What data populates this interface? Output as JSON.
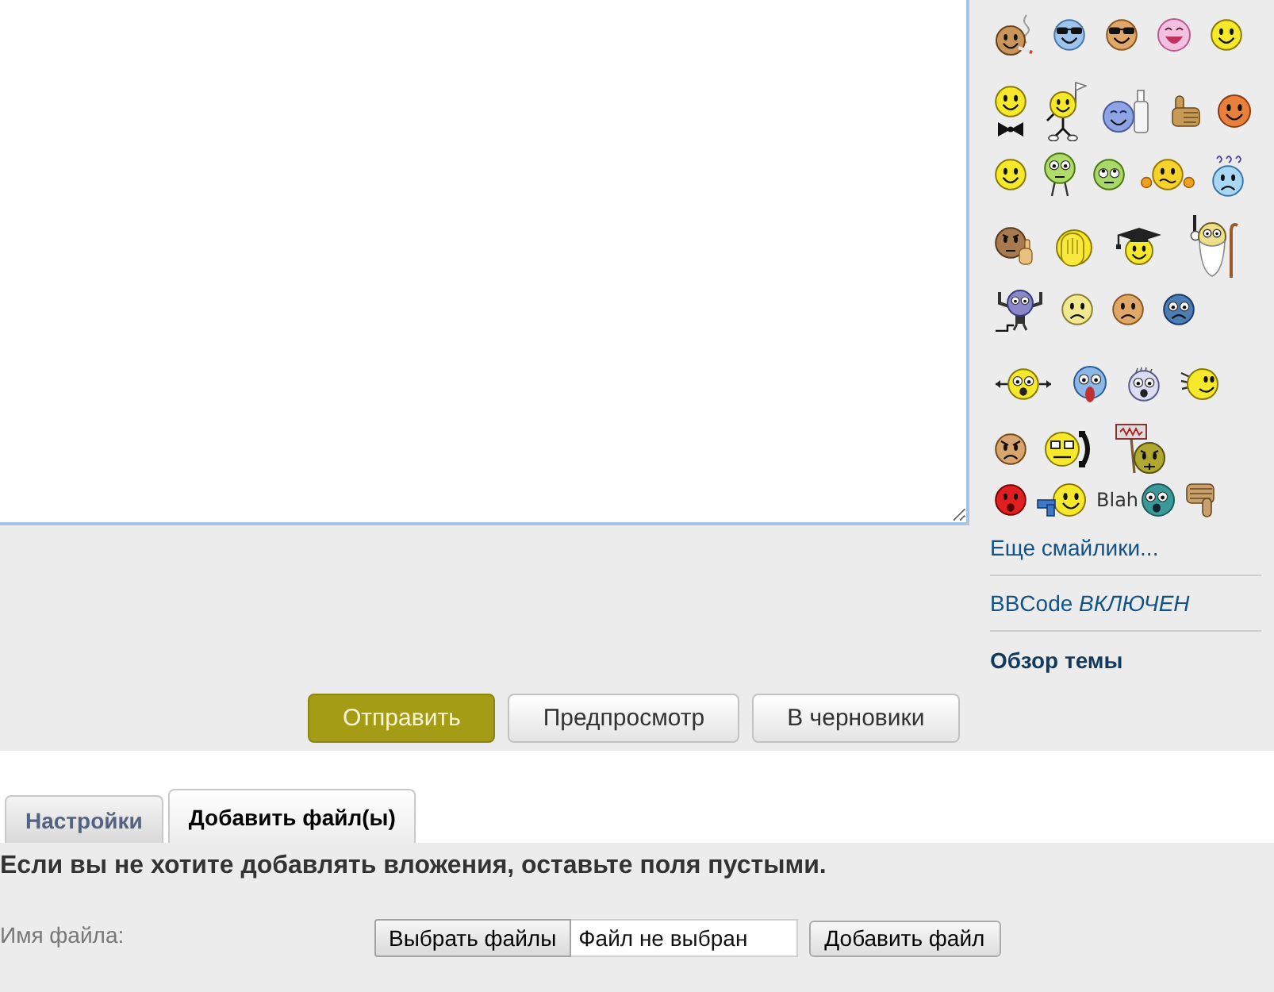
{
  "sidebar": {
    "smiley_rows": [
      {
        "smileys": [
          {
            "kind": "smoking"
          },
          {
            "kind": "cool"
          },
          {
            "kind": "shades"
          },
          {
            "kind": "laughing"
          },
          {
            "kind": "smile"
          }
        ]
      },
      {
        "smileys": [
          {
            "kind": "bowtie"
          },
          {
            "kind": "cheering"
          },
          {
            "kind": "bottle"
          },
          {
            "kind": "thumbsup"
          },
          {
            "kind": "grin"
          }
        ]
      },
      {
        "smileys": [
          {
            "kind": "smile"
          },
          {
            "kind": "dizzy"
          },
          {
            "kind": "eyeroll"
          },
          {
            "kind": "shrug"
          },
          {
            "kind": "confused"
          }
        ]
      },
      {
        "smileys": [
          {
            "kind": "pointing"
          },
          {
            "kind": "facepalm"
          },
          {
            "kind": "graduate"
          },
          {
            "kind": "wizard"
          }
        ]
      },
      {
        "smileys": [
          {
            "kind": "flexing"
          },
          {
            "kind": "sad"
          },
          {
            "kind": "frown"
          },
          {
            "kind": "worried"
          }
        ]
      },
      {
        "smileys": [
          {
            "kind": "crazy"
          },
          {
            "kind": "scared"
          },
          {
            "kind": "shocked"
          },
          {
            "kind": "running"
          }
        ]
      },
      {
        "smileys": [
          {
            "kind": "angry"
          },
          {
            "kind": "phone"
          },
          {
            "kind": "protest"
          }
        ]
      },
      {
        "smileys": [
          {
            "kind": "mad"
          },
          {
            "kind": "shooting"
          },
          {
            "kind": "blah",
            "caption": "Blah"
          },
          {
            "kind": "thumbsdown"
          }
        ]
      }
    ],
    "more_smileys_link": "Еще смайлики...",
    "bbcode_status": "BBCode *ВКЛЮЧЕН*",
    "topic_review_link": "Обзор темы"
  },
  "actions": [
    {
      "label": "Отправить",
      "kind": "primary"
    },
    {
      "label": "Предпросмотр",
      "kind": "secondary"
    },
    {
      "label": "В черновики",
      "kind": "secondary"
    }
  ],
  "tabs": [
    {
      "label": "Настройки",
      "selected": false
    },
    {
      "label": "Добавить файл(ы)",
      "selected": true
    }
  ],
  "attachments": {
    "hint": "Если вы не хотите добавлять вложения, оставьте поля пустыми.",
    "file_label": "Имя файла:",
    "choose_button": "Выбрать файлы",
    "file_status": "Файл не выбран",
    "add_button": "Добавить файл"
  }
}
